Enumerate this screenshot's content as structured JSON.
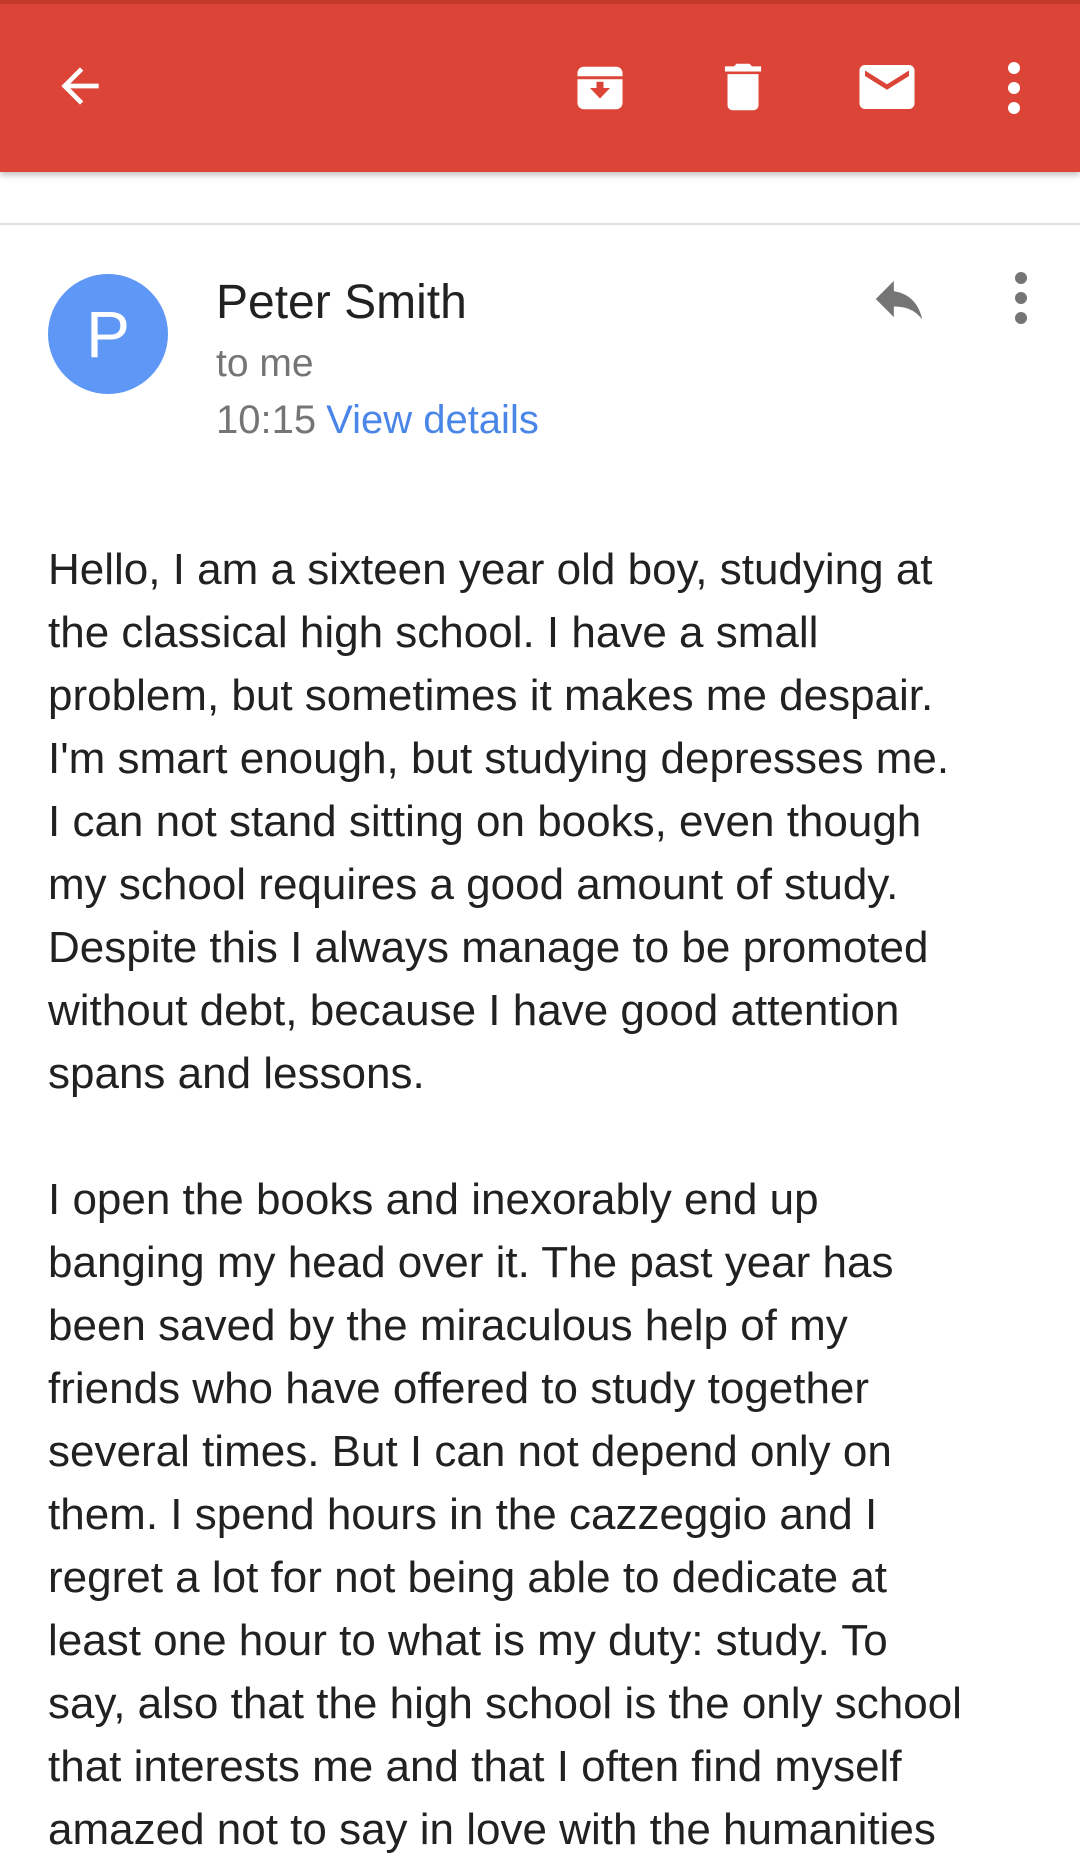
{
  "toolbar": {
    "back_icon": "arrow-left-icon",
    "archive_icon": "archive-icon",
    "delete_icon": "trash-icon",
    "mark_unread_icon": "envelope-icon",
    "overflow_icon": "more-vert-icon",
    "background_color": "#db4437"
  },
  "message": {
    "avatar_letter": "P",
    "avatar_color": "#5e97f6",
    "sender": "Peter Smith",
    "recipient": "to me",
    "time": "10:15",
    "details_link": "View details",
    "reply_icon": "reply-icon",
    "overflow_icon": "more-vert-icon"
  },
  "body": {
    "paragraphs": [
      [
        "Hello, I am a sixteen year old boy, studying at",
        "the classical high school. I have a small",
        "problem, but sometimes it makes me despair.",
        "I'm smart enough, but studying depresses me.",
        "I can not stand sitting on books, even though",
        "my school requires a good amount of study.",
        "Despite this I always manage to be promoted",
        "without debt, because I have good attention",
        "spans and lessons."
      ],
      [
        "I open the books and inexorably end up",
        "banging my head over it. The past year has",
        "been saved by the miraculous help of my",
        "friends who have offered to study together",
        "several times. But I can not depend only on",
        "them. I spend hours in the cazzeggio and I",
        "regret a lot for not being able to dedicate at",
        "least one hour to what is my duty: study. To",
        "say, also that the high school is the only school",
        "that interests me and that I often find myself",
        "amazed not to say in love with the humanities"
      ]
    ]
  }
}
